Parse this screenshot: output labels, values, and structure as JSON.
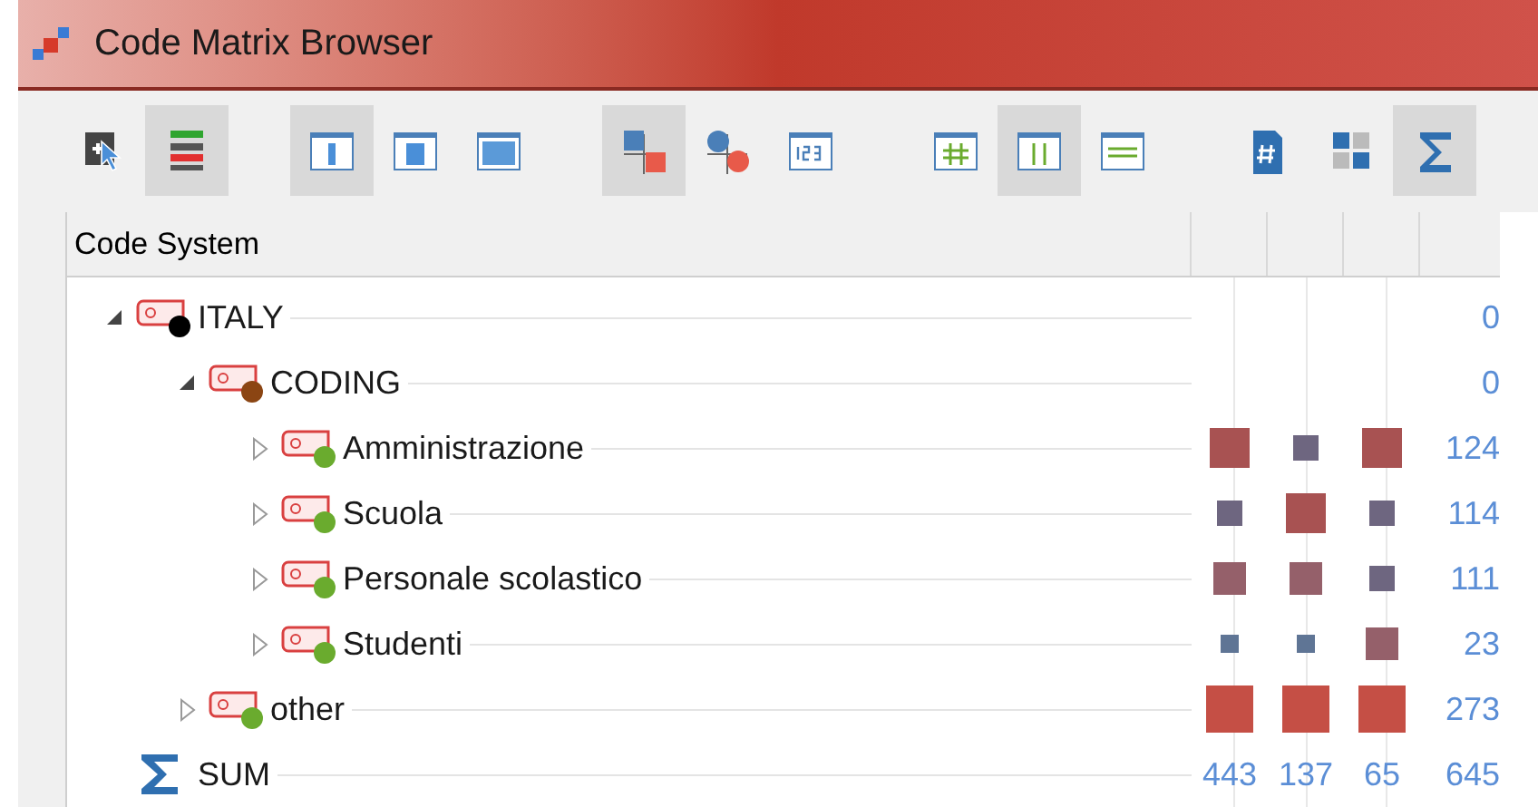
{
  "window": {
    "title": "Code Matrix Browser"
  },
  "toolbar": [
    {
      "kind": "select",
      "selected": false
    },
    {
      "kind": "bars",
      "selected": true
    },
    {
      "kind": "panel-narrow",
      "selected": true
    },
    {
      "kind": "panel-medium",
      "selected": false
    },
    {
      "kind": "panel-wide",
      "selected": false
    },
    {
      "kind": "squares",
      "selected": true
    },
    {
      "kind": "circles",
      "selected": false
    },
    {
      "kind": "numbers",
      "selected": false
    },
    {
      "kind": "grid",
      "selected": false
    },
    {
      "kind": "columns",
      "selected": true
    },
    {
      "kind": "rows",
      "selected": false
    },
    {
      "kind": "document",
      "selected": false
    },
    {
      "kind": "ones",
      "selected": false
    },
    {
      "kind": "sum",
      "selected": true
    }
  ],
  "table": {
    "columns": [
      "Code System"
    ],
    "rows": [
      {
        "label": "ITALY",
        "expanded": true,
        "color": "#000000",
        "total": "0",
        "children": [
          {
            "label": "CODING",
            "expanded": true,
            "color": "#8b4513",
            "total": "0",
            "children": [
              {
                "label": "Amministrazione",
                "expanded": false,
                "color": "#6aab2e",
                "total": "124",
                "cells": [
                  {
                    "kind": "large",
                    "color": "#a85252"
                  },
                  {
                    "kind": "small",
                    "color": "#6e6680"
                  },
                  {
                    "kind": "large",
                    "color": "#a85252"
                  }
                ]
              },
              {
                "label": "Scuola",
                "expanded": false,
                "color": "#6aab2e",
                "total": "114",
                "cells": [
                  {
                    "kind": "small",
                    "color": "#6e6680"
                  },
                  {
                    "kind": "large",
                    "color": "#a85252"
                  },
                  {
                    "kind": "small",
                    "color": "#6e6680"
                  }
                ]
              },
              {
                "label": "Personale scolastico",
                "expanded": false,
                "color": "#6aab2e",
                "total": "111",
                "cells": [
                  {
                    "kind": "medium",
                    "color": "#95606a"
                  },
                  {
                    "kind": "medium",
                    "color": "#95606a"
                  },
                  {
                    "kind": "small",
                    "color": "#6e6680"
                  }
                ]
              },
              {
                "label": "Studenti",
                "expanded": false,
                "color": "#6aab2e",
                "total": "23",
                "cells": [
                  {
                    "kind": "tiny",
                    "color": "#5f7595"
                  },
                  {
                    "kind": "tiny",
                    "color": "#5f7595"
                  },
                  {
                    "kind": "medium",
                    "color": "#95606a"
                  }
                ]
              }
            ]
          },
          {
            "label": "other",
            "expanded": false,
            "color": "#6aab2e",
            "total": "273",
            "cells": [
              {
                "kind": "xlarge",
                "color": "#c54f45"
              },
              {
                "kind": "xlarge",
                "color": "#c54f45"
              },
              {
                "kind": "xlarge",
                "color": "#c54f45"
              }
            ]
          }
        ]
      }
    ],
    "sum": {
      "label": "SUM",
      "totals": [
        "443",
        "137",
        "65",
        "645"
      ]
    }
  }
}
